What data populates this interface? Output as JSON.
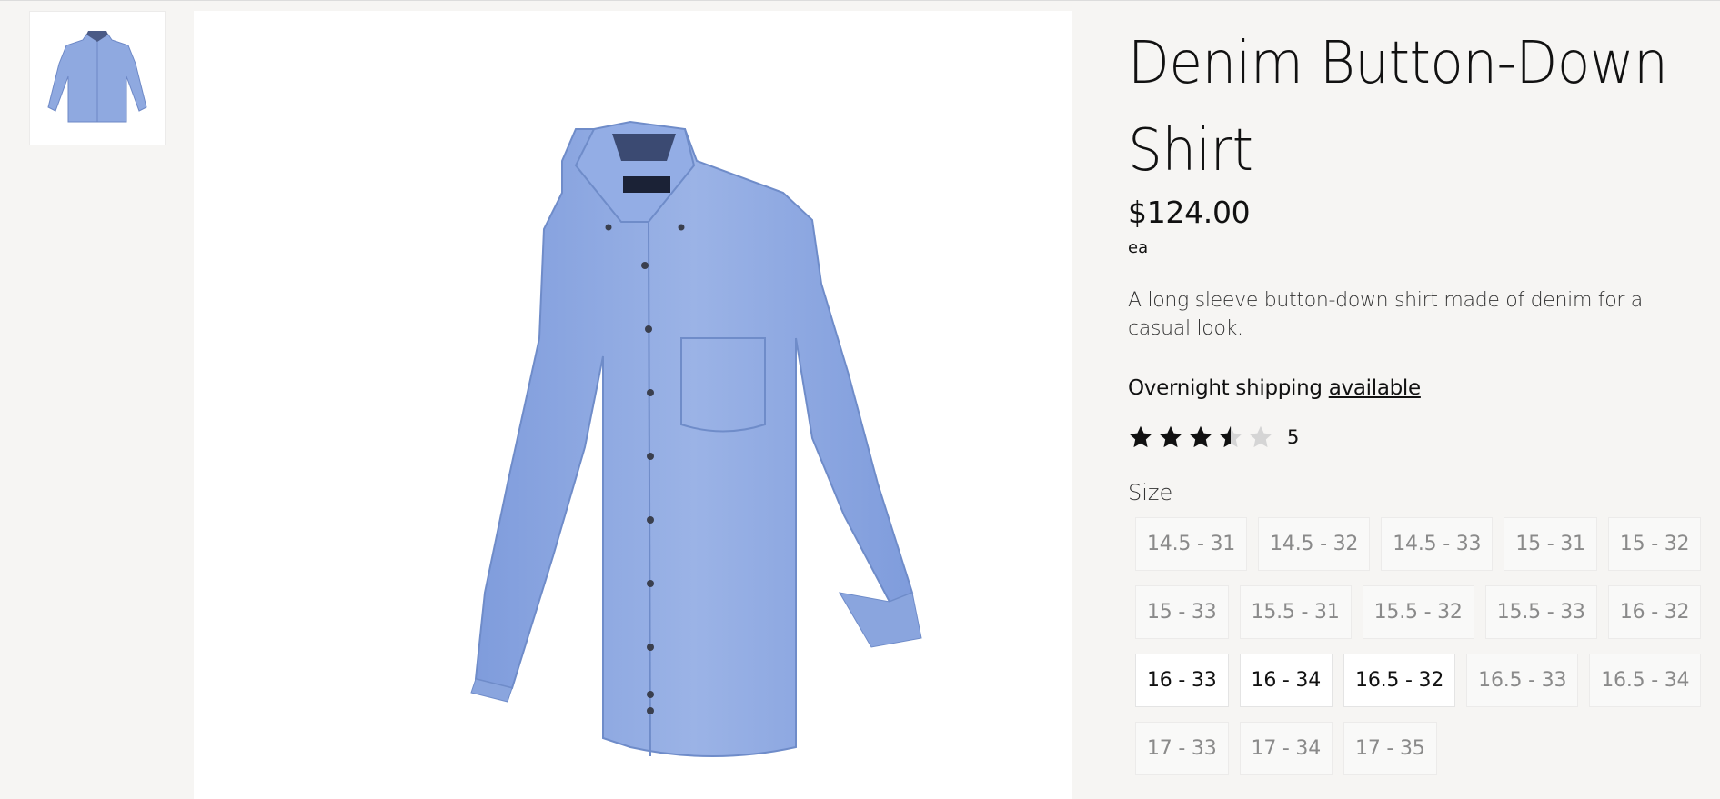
{
  "product": {
    "title": "Denim Button-Down Shirt",
    "price": "$124.00",
    "unit": "ea",
    "description": "A long sleeve button-down shirt made of denim for a casual look.",
    "shipping_text": "Overnight shipping",
    "shipping_link": "available",
    "rating": {
      "value": 3.5,
      "max": 5,
      "count_label": "5"
    },
    "size_label": "Size",
    "size_rows": [
      [
        {
          "label": "14.5 - 31",
          "available": false
        },
        {
          "label": "14.5 - 32",
          "available": false
        },
        {
          "label": "14.5 - 33",
          "available": false
        },
        {
          "label": "15 - 31",
          "available": false
        },
        {
          "label": "15 - 32",
          "available": false
        }
      ],
      [
        {
          "label": "15 - 33",
          "available": false
        },
        {
          "label": "15.5 - 31",
          "available": false
        },
        {
          "label": "15.5 - 32",
          "available": false
        },
        {
          "label": "15.5 - 33",
          "available": false
        },
        {
          "label": "16 - 32",
          "available": false
        }
      ],
      [
        {
          "label": "16 - 33",
          "available": true
        },
        {
          "label": "16 - 34",
          "available": true
        },
        {
          "label": "16.5 - 32",
          "available": true
        },
        {
          "label": "16.5 - 33",
          "available": false
        },
        {
          "label": "16.5 - 34",
          "available": false
        }
      ],
      [
        {
          "label": "17 - 33",
          "available": false
        },
        {
          "label": "17 - 34",
          "available": false
        },
        {
          "label": "17 - 35",
          "available": false
        }
      ]
    ]
  },
  "gallery": {
    "thumbnail_icon": "shirt-thumbnail-image",
    "main_icon": "shirt-main-image"
  },
  "colors": {
    "background": "#f6f5f3",
    "star_filled": "#111111",
    "star_empty": "#d5d5d5",
    "shirt_blue": "#8fa9e0",
    "size_available_text": "#111111",
    "size_unavailable_text": "#8a8a8a"
  }
}
